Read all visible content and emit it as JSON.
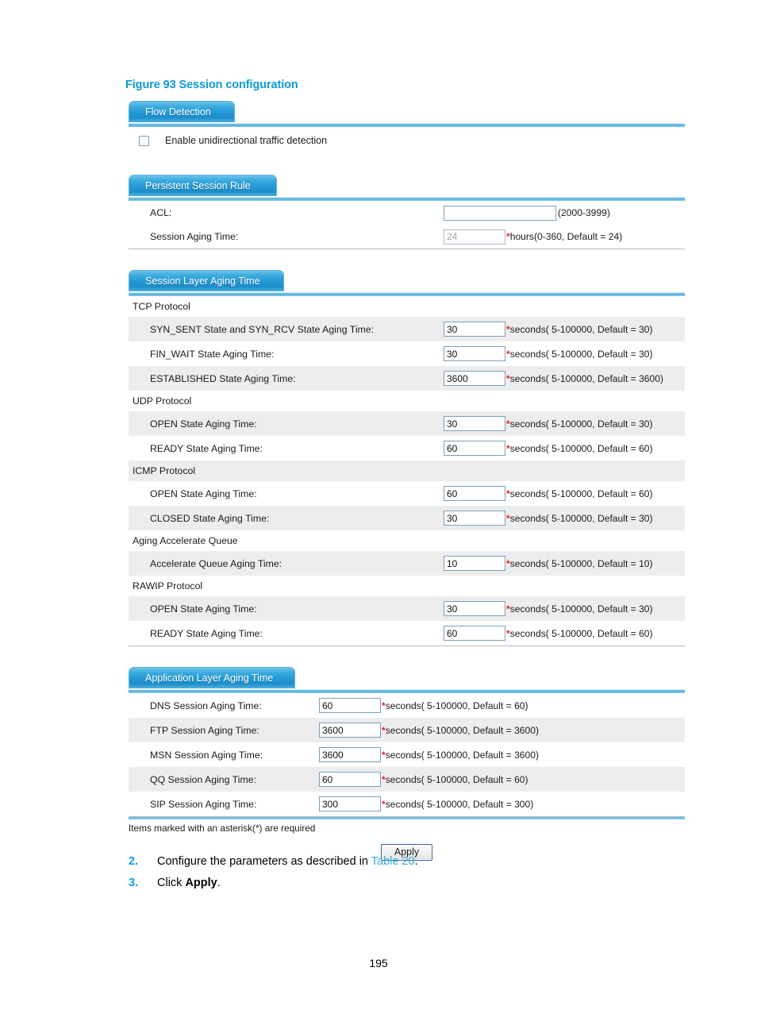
{
  "figure": {
    "caption": "Figure 93 Session configuration"
  },
  "panels": {
    "flow_detection": {
      "tab_label": "Flow Detection",
      "checkbox_label": "Enable unidirectional traffic detection",
      "checkbox_checked": false
    },
    "persistent_session_rule": {
      "tab_label": "Persistent Session Rule",
      "rows": [
        {
          "label": "ACL:",
          "value": "",
          "disabled": false,
          "required": false,
          "hint": "(2000-3999)"
        },
        {
          "label": "Session Aging Time:",
          "value": "24",
          "disabled": true,
          "required": true,
          "hint": "hours(0-360, Default = 24)"
        }
      ]
    },
    "session_layer_aging_time": {
      "tab_label": "Session Layer Aging Time",
      "groups": [
        {
          "title": "TCP Protocol",
          "rows": [
            {
              "label": "SYN_SENT State and SYN_RCV State Aging Time:",
              "value": "30",
              "required": true,
              "hint": "seconds( 5-100000, Default = 30)"
            },
            {
              "label": "FIN_WAIT State Aging Time:",
              "value": "30",
              "required": true,
              "hint": "seconds( 5-100000, Default = 30)"
            },
            {
              "label": "ESTABLISHED State Aging Time:",
              "value": "3600",
              "required": true,
              "hint": "seconds( 5-100000, Default = 3600)"
            }
          ]
        },
        {
          "title": "UDP Protocol",
          "rows": [
            {
              "label": "OPEN State Aging Time:",
              "value": "30",
              "required": true,
              "hint": "seconds( 5-100000, Default = 30)"
            },
            {
              "label": "READY State Aging Time:",
              "value": "60",
              "required": true,
              "hint": "seconds( 5-100000, Default = 60)"
            }
          ]
        },
        {
          "title": "ICMP Protocol",
          "rows": [
            {
              "label": "OPEN State Aging Time:",
              "value": "60",
              "required": true,
              "hint": "seconds( 5-100000, Default = 60)"
            },
            {
              "label": "CLOSED State Aging Time:",
              "value": "30",
              "required": true,
              "hint": "seconds( 5-100000, Default = 30)"
            }
          ]
        },
        {
          "title": "Aging Accelerate Queue",
          "rows": [
            {
              "label": "Accelerate Queue Aging Time:",
              "value": "10",
              "required": true,
              "hint": "seconds( 5-100000, Default = 10)"
            }
          ]
        },
        {
          "title": "RAWIP Protocol",
          "rows": [
            {
              "label": "OPEN State Aging Time:",
              "value": "30",
              "required": true,
              "hint": "seconds( 5-100000, Default = 30)"
            },
            {
              "label": "READY State Aging Time:",
              "value": "60",
              "required": true,
              "hint": "seconds( 5-100000, Default = 60)"
            }
          ]
        }
      ]
    },
    "application_layer_aging_time": {
      "tab_label": "Application Layer Aging Time",
      "rows": [
        {
          "label": "DNS Session Aging Time:",
          "value": "60",
          "required": true,
          "hint": "seconds( 5-100000, Default = 60)"
        },
        {
          "label": "FTP Session Aging Time:",
          "value": "3600",
          "required": true,
          "hint": "seconds( 5-100000, Default = 3600)"
        },
        {
          "label": "MSN Session Aging Time:",
          "value": "3600",
          "required": true,
          "hint": "seconds( 5-100000, Default = 3600)"
        },
        {
          "label": "QQ Session Aging Time:",
          "value": "60",
          "required": true,
          "hint": "seconds( 5-100000, Default = 60)"
        },
        {
          "label": "SIP Session Aging Time:",
          "value": "300",
          "required": true,
          "hint": "seconds( 5-100000, Default = 300)"
        }
      ]
    }
  },
  "footer": {
    "required_note": "Items marked with an asterisk(*) are required",
    "apply_label": "Apply"
  },
  "steps": [
    {
      "number": "2.",
      "text_before": "Configure the parameters as described in ",
      "link": "Table 20",
      "text_after": "."
    },
    {
      "number": "3.",
      "text_before": "Click ",
      "bold": "Apply",
      "text_after": "."
    }
  ],
  "page_number": "195",
  "colors": {
    "accent_blue": "#0a9bd7",
    "link_blue": "#39a9dc",
    "tab_blue": "#2197d3",
    "row_alt": "#ededed",
    "required_star": "#ef1c24"
  }
}
